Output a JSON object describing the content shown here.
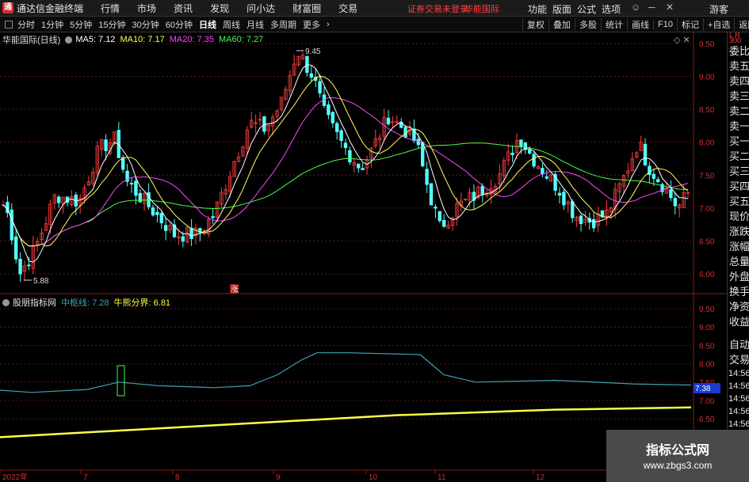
{
  "menubar": {
    "app_title": "通达信金融终端",
    "items": [
      "行情",
      "市场",
      "资讯",
      "发现",
      "问小达",
      "财富圈",
      "交易"
    ],
    "notice": "证券交易未登录",
    "stock_name": "华能国际",
    "right_items": [
      "功能",
      "版面",
      "公式",
      "选项"
    ],
    "guest": "游客"
  },
  "toolbar": {
    "periods": [
      "分时",
      "1分钟",
      "5分钟",
      "15分钟",
      "30分钟",
      "60分钟",
      "日线",
      "周线",
      "月线",
      "多周期",
      "更多"
    ],
    "active_period": "日线",
    "right_buttons": [
      "复权",
      "叠加",
      "多股",
      "统计",
      "画线",
      "F10",
      "标记",
      "+自选",
      "返回"
    ]
  },
  "main_chart": {
    "symbol": "华能国际(日线)",
    "ma": [
      {
        "label": "MA5: 7.12",
        "color": "#ffffff"
      },
      {
        "label": "MA10: 7.17",
        "color": "#ffff55"
      },
      {
        "label": "MA20: 7.35",
        "color": "#ff44ff"
      },
      {
        "label": "MA60: 7.27",
        "color": "#44ff44"
      }
    ],
    "y_ticks": [
      "9.50",
      "9.00",
      "8.50",
      "8.00",
      "7.50",
      "7.00",
      "6.50",
      "6.00"
    ],
    "high_label": "9.45",
    "low_label": "5.88",
    "limit_marker": "涨"
  },
  "sub_chart": {
    "name": "股朋指标网",
    "mid_label": "中枢线: 7.28",
    "bull_label": "牛熊分界: 6.81",
    "y_ticks": [
      "9.50",
      "9.00",
      "8.50",
      "8.00",
      "7.50",
      "7.00",
      "6.50"
    ],
    "price_tag": "7.38"
  },
  "x_axis": [
    "2022年",
    "7",
    "8",
    "9",
    "10",
    "11",
    "12"
  ],
  "right_panel": {
    "items": [
      "委比",
      "卖五",
      "卖四",
      "卖三",
      "卖二",
      "卖一",
      "买一",
      "买二",
      "买三",
      "买四",
      "买五",
      "现价",
      "涨跌",
      "涨幅",
      "总量",
      "外盘",
      "换手",
      "净资",
      "收益"
    ],
    "trade_items": [
      "自动",
      "交易"
    ],
    "times": [
      "14:56",
      "14:56",
      "14:56",
      "14:56",
      "14:56",
      "14:56",
      "14:56",
      "14:56"
    ],
    "badge": "L R 300"
  },
  "watermark": {
    "line1": "指标公式网",
    "line2": "www.zbgs3.com"
  },
  "colors": {
    "up": "#ff3c3c",
    "down": "#54ffff",
    "ma5": "#ffffff",
    "ma10": "#ffff55",
    "ma20": "#ff44ff",
    "ma60": "#44ff44",
    "mid_line": "#3fa0b0",
    "bull_line": "#ffff44"
  }
}
